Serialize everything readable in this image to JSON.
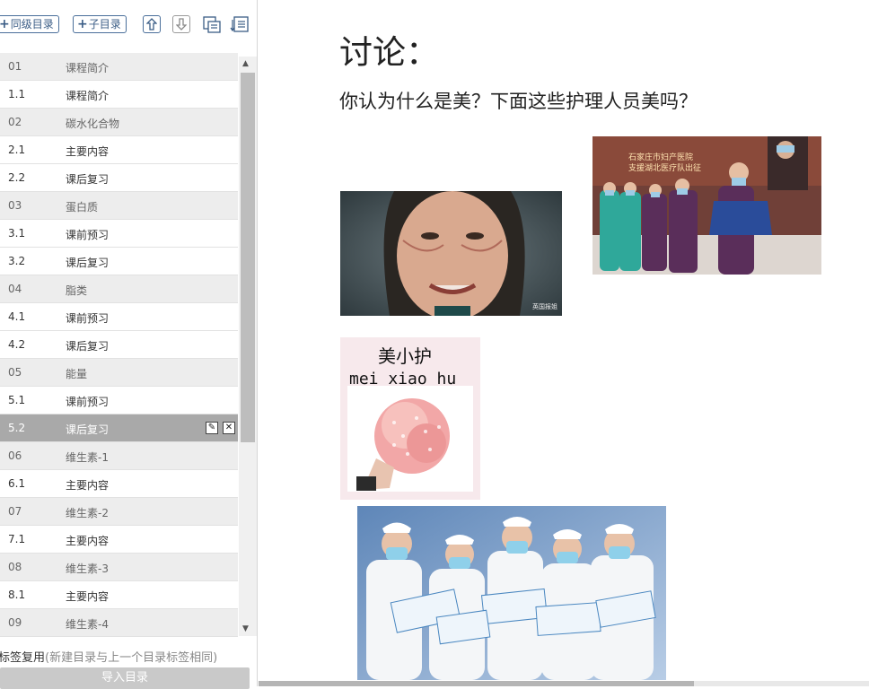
{
  "toolbar": {
    "add_sibling_label": "同级目录",
    "add_child_label": "子目录"
  },
  "outline": [
    {
      "num": "01",
      "label": "课程简介",
      "level": "chapter"
    },
    {
      "num": "1.1",
      "label": "课程简介",
      "level": "sub"
    },
    {
      "num": "02",
      "label": "碳水化合物",
      "level": "chapter"
    },
    {
      "num": "2.1",
      "label": "主要内容",
      "level": "sub"
    },
    {
      "num": "2.2",
      "label": "课后复习",
      "level": "sub"
    },
    {
      "num": "03",
      "label": "蛋白质",
      "level": "chapter"
    },
    {
      "num": "3.1",
      "label": "课前预习",
      "level": "sub"
    },
    {
      "num": "3.2",
      "label": "课后复习",
      "level": "sub"
    },
    {
      "num": "04",
      "label": "脂类",
      "level": "chapter"
    },
    {
      "num": "4.1",
      "label": "课前预习",
      "level": "sub"
    },
    {
      "num": "4.2",
      "label": "课后复习",
      "level": "sub"
    },
    {
      "num": "05",
      "label": "能量",
      "level": "chapter"
    },
    {
      "num": "5.1",
      "label": "课前预习",
      "level": "sub"
    },
    {
      "num": "5.2",
      "label": "课后复习",
      "level": "selected"
    },
    {
      "num": "06",
      "label": "维生素-1",
      "level": "chapter"
    },
    {
      "num": "6.1",
      "label": "主要内容",
      "level": "sub"
    },
    {
      "num": "07",
      "label": "维生素-2",
      "level": "chapter"
    },
    {
      "num": "7.1",
      "label": "主要内容",
      "level": "sub"
    },
    {
      "num": "08",
      "label": "维生素-3",
      "level": "chapter"
    },
    {
      "num": "8.1",
      "label": "主要内容",
      "level": "sub"
    },
    {
      "num": "09",
      "label": "维生素-4",
      "level": "chapter"
    }
  ],
  "footer": {
    "reuse_label": "标签复用",
    "reuse_hint": "(新建目录与上一个目录标签相同)",
    "import_label": "导入目录"
  },
  "content": {
    "title": "讨论：",
    "question": "你认为什么是美？下面这些护理人员美吗？",
    "image1_caption": "英国报姐",
    "image2_banner": "石家庄市妇产医院",
    "image2_banner2": "支援湖北医疗队出征",
    "image3_title": "美小护",
    "image3_pinyin": "mei xiao hu"
  },
  "colors": {
    "selected_row": "#a9a9a9",
    "chapter_row": "#ededed",
    "button_border": "#4a6f9a"
  }
}
